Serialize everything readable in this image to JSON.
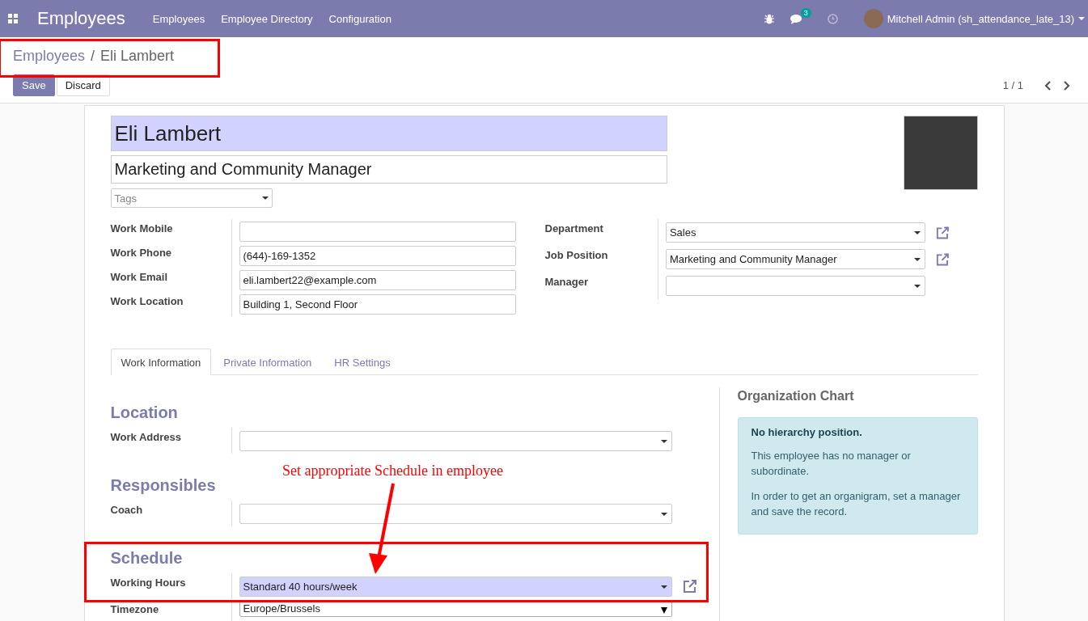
{
  "navbar": {
    "app_title": "Employees",
    "menu": [
      {
        "label": "Employees"
      },
      {
        "label": "Employee Directory"
      },
      {
        "label": "Configuration"
      }
    ],
    "chat_count": "3",
    "user": "Mitchell Admin (sh_attendance_late_13)"
  },
  "breadcrumb": {
    "items": [
      {
        "label": "Employees",
        "kind": "link"
      },
      {
        "label": "Eli Lambert",
        "kind": "current"
      }
    ],
    "separator": "/"
  },
  "buttons": [
    {
      "label": "Save",
      "kind": "primary"
    },
    {
      "label": "Discard",
      "kind": "secondary"
    }
  ],
  "pager": "1 / 1",
  "form": {
    "name": "Eli Lambert",
    "job_title": "Marketing and Community Manager",
    "tags_placeholder": "Tags",
    "left_fields": [
      {
        "label": "Work Mobile"
      },
      {
        "label": "Work Phone",
        "value": "(644)-169-1352"
      },
      {
        "label": "Work Email",
        "value": "eli.lambert22@example.com"
      },
      {
        "label": "Work Location",
        "value": "Building 1, Second Floor"
      }
    ],
    "right_fields": [
      {
        "label": "Department",
        "value": "Sales",
        "external_link": true
      },
      {
        "label": "Job Position",
        "value": "Marketing and Community Manager",
        "external_link": true
      },
      {
        "label": "Manager",
        "external_link": false
      }
    ]
  },
  "tabs": [
    {
      "label": "Work Information",
      "selected": true
    },
    {
      "label": "Private Information",
      "selected": false
    },
    {
      "label": "HR Settings",
      "selected": false
    }
  ],
  "sections": [
    {
      "title": "Location",
      "fields": [
        {
          "label": "Work Address",
          "kind": "many2one",
          "required": false,
          "external_link": false
        }
      ]
    },
    {
      "title": "Responsibles",
      "fields": [
        {
          "label": "Coach",
          "kind": "many2one",
          "required": false,
          "external_link": false
        }
      ]
    },
    {
      "title": "Schedule",
      "fields": [
        {
          "label": "Working Hours",
          "value": "Standard 40 hours/week",
          "kind": "many2one",
          "required": true,
          "external_link": true
        },
        {
          "label": "Timezone",
          "value": "Europe/Brussels",
          "kind": "native",
          "required": false,
          "external_link": false
        }
      ]
    }
  ],
  "org_chart": {
    "title": "Organization Chart",
    "alert_title": "No hierarchy position.",
    "paragraphs": [
      "This employee has no manager or subordinate.",
      "In order to get an organigram, set a manager and save the record."
    ]
  },
  "annotation": {
    "note": "Set appropriate Schedule in employee"
  }
}
